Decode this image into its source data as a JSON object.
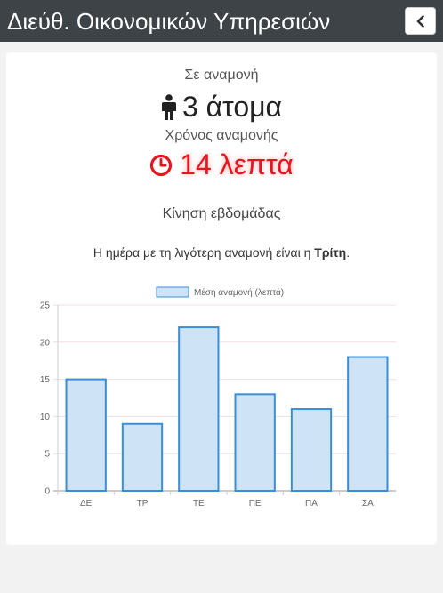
{
  "header": {
    "title": "Διεύθ. Οικονομικών Υπηρεσιών",
    "back_icon": "chevron-left-icon"
  },
  "status": {
    "waiting_label": "Σε αναμονή",
    "people_count": "3 άτομα",
    "people_icon": "person-icon",
    "wait_time_label": "Χρόνος αναμονής",
    "wait_time_value": "14 λεπτά",
    "clock_icon": "clock-icon",
    "accent_color": "#e8141e"
  },
  "week": {
    "title": "Κίνηση εβδομάδας",
    "best_day_prefix": "Η ημέρα με τη λιγότερη αναμονή είναι η ",
    "best_day_name": "Τρίτη",
    "best_day_suffix": "."
  },
  "chart_data": {
    "type": "bar",
    "categories": [
      "ΔΕ",
      "ΤΡ",
      "ΤΕ",
      "ΠΕ",
      "ΠΑ",
      "ΣΑ"
    ],
    "series": [
      {
        "name": "Μέση αναμονή (λεπτά)",
        "values": [
          15,
          9,
          22,
          13,
          11,
          18
        ]
      }
    ],
    "ylim": [
      0,
      25
    ],
    "yticks": [
      0,
      5,
      10,
      15,
      20,
      25
    ],
    "legend_position": "top",
    "grid": true,
    "bar_fill": "#cfe3f7",
    "bar_stroke": "#3a8ed6",
    "grid_color": "#f3dde3"
  }
}
